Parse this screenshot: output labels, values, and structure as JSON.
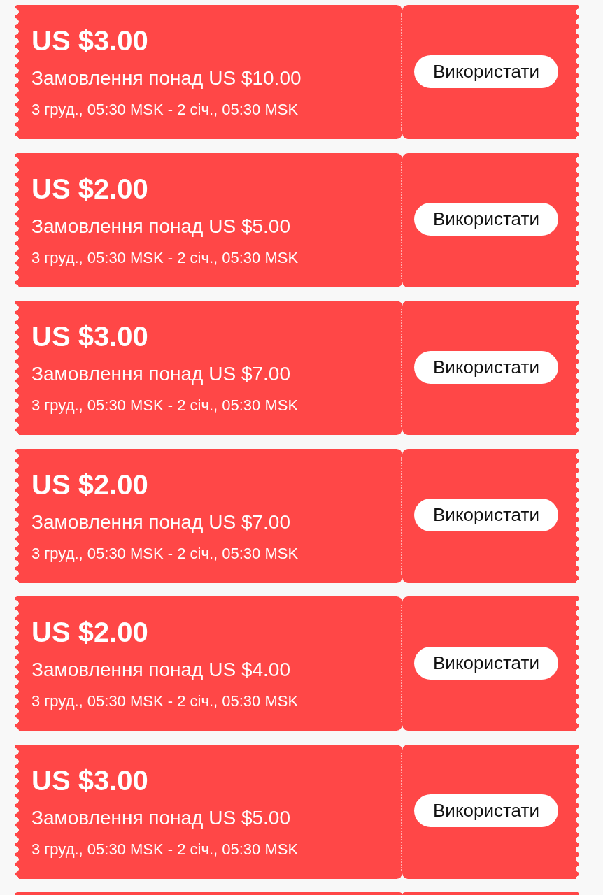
{
  "coupons": [
    {
      "amount": "US $3.00",
      "condition": "Замовлення понад US $10.00",
      "validity": "3 груд., 05:30 MSK - 2 січ., 05:30 MSK",
      "button": "Використати"
    },
    {
      "amount": "US $2.00",
      "condition": "Замовлення понад US $5.00",
      "validity": "3 груд., 05:30 MSK - 2 січ., 05:30 MSK",
      "button": "Використати"
    },
    {
      "amount": "US $3.00",
      "condition": "Замовлення понад US $7.00",
      "validity": "3 груд., 05:30 MSK - 2 січ., 05:30 MSK",
      "button": "Використати"
    },
    {
      "amount": "US $2.00",
      "condition": "Замовлення понад US $7.00",
      "validity": "3 груд., 05:30 MSK - 2 січ., 05:30 MSK",
      "button": "Використати"
    },
    {
      "amount": "US $2.00",
      "condition": "Замовлення понад US $4.00",
      "validity": "3 груд., 05:30 MSK - 2 січ., 05:30 MSK",
      "button": "Використати"
    },
    {
      "amount": "US $3.00",
      "condition": "Замовлення понад US $5.00",
      "validity": "3 груд., 05:30 MSK - 2 січ., 05:30 MSK",
      "button": "Використати"
    }
  ]
}
